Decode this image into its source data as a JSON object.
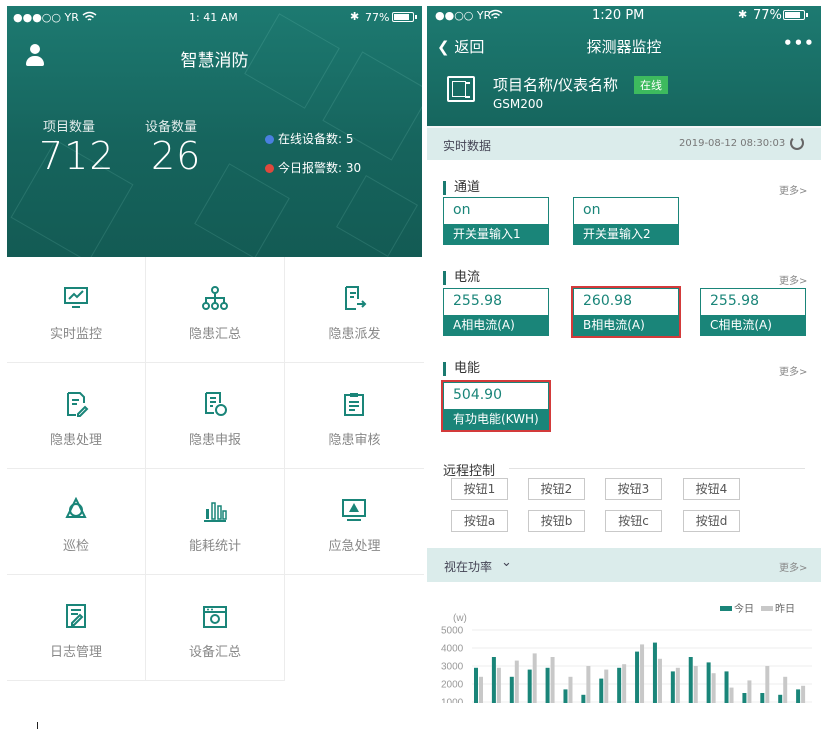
{
  "left": {
    "status": {
      "carrier": "●●●○○ YR",
      "time": "1: 41 AM",
      "battery_text": "77%",
      "battery_level": 0.77
    },
    "app_title": "智慧消防",
    "stats": [
      {
        "label": "项目数量",
        "value": "712"
      },
      {
        "label": "设备数量",
        "value": "26"
      }
    ],
    "online_devices": "在线设备数: 5",
    "today_alarms": "今日报警数: 30",
    "menu": [
      {
        "label": "实时监控",
        "icon": "monitor-chart-icon"
      },
      {
        "label": "隐患汇总",
        "icon": "hierarchy-icon"
      },
      {
        "label": "隐患派发",
        "icon": "document-send-icon"
      },
      {
        "label": "隐患处理",
        "icon": "document-edit-icon"
      },
      {
        "label": "隐患申报",
        "icon": "report-icon"
      },
      {
        "label": "隐患审核",
        "icon": "clipboard-icon"
      },
      {
        "label": "巡检",
        "icon": "patrol-icon"
      },
      {
        "label": "能耗统计",
        "icon": "bar-chart-icon"
      },
      {
        "label": "应急处理",
        "icon": "warning-screen-icon"
      },
      {
        "label": "日志管理",
        "icon": "log-edit-icon"
      },
      {
        "label": "设备汇总",
        "icon": "device-box-icon"
      }
    ],
    "colors": {
      "header": "#1a7068",
      "alert_online": "#4a7fe0",
      "alert_red": "#e0483d"
    }
  },
  "right": {
    "status": {
      "carrier": "●●○○ YR",
      "time": "1:20 PM",
      "battery_text": "77%",
      "battery_level": 0.77
    },
    "back_label": "返回",
    "title": "探测器监控",
    "project_name": "项目名称/仪表名称",
    "online_badge": "在线",
    "model": "GSM200",
    "realtime_label": "实时数据",
    "datetime": "2019-08-12 08:30:03",
    "more": "更多>",
    "channel": {
      "title": "通道",
      "items": [
        {
          "value": "on",
          "name": "开关量输入1"
        },
        {
          "value": "on",
          "name": "开关量输入2"
        }
      ]
    },
    "current": {
      "title": "电流",
      "items": [
        {
          "value": "255.98",
          "name": "A相电流(A)"
        },
        {
          "value": "260.98",
          "name": "B相电流(A)"
        },
        {
          "value": "255.98",
          "name": "C相电流(A)"
        }
      ]
    },
    "energy": {
      "title": "电能",
      "items": [
        {
          "value": "504.90",
          "name": "有功电能(KWH)"
        }
      ]
    },
    "remote": {
      "title": "远程控制",
      "buttons": [
        "按钮1",
        "按钮2",
        "按钮3",
        "按钮4",
        "按钮a",
        "按钮b",
        "按钮c",
        "按钮d"
      ]
    },
    "power_selector": "视在功率",
    "colors": {
      "primary": "#1a8579",
      "highlight": "#d33a3a",
      "online": "#3dba5e",
      "today": "#1a8579",
      "yesterday": "#c8c8c8"
    }
  },
  "chart_data": {
    "type": "bar",
    "ylabel": "(w)",
    "yticks": [
      5000,
      4000,
      3000,
      2000,
      1000
    ],
    "ylim": [
      1000,
      5000
    ],
    "legend_position": "top-right",
    "series": [
      {
        "name": "今日",
        "values": [
          2900,
          3500,
          2400,
          2800,
          2900,
          1700,
          1400,
          2300,
          2900,
          3800,
          4300,
          2700,
          3500,
          3200,
          2700,
          1500,
          1500,
          1400,
          1700
        ]
      },
      {
        "name": "昨日",
        "values": [
          2400,
          2900,
          3300,
          3700,
          3500,
          2400,
          3000,
          2800,
          3100,
          4200,
          3400,
          2900,
          3000,
          2600,
          1800,
          2200,
          3000,
          2400,
          1900
        ]
      }
    ]
  }
}
